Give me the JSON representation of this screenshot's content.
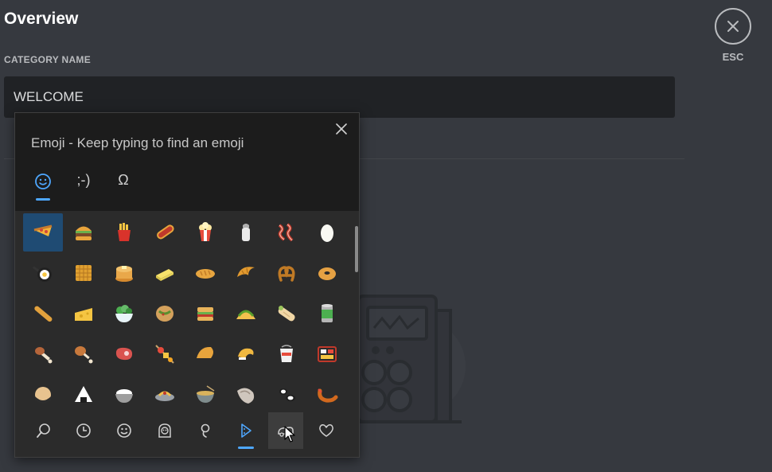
{
  "page": {
    "title": "Overview"
  },
  "category": {
    "label": "CATEGORY NAME",
    "value": "WELCOME"
  },
  "close": {
    "esc_label": "ESC"
  },
  "emoji_panel": {
    "hint": "Emoji - Keep typing to find an emoji",
    "tabs": [
      {
        "name": "emoji",
        "icon": "smiley-icon",
        "active": true
      },
      {
        "name": "kaomoji",
        "label": ";-)",
        "active": false
      },
      {
        "name": "symbols",
        "label": "Ω",
        "active": false
      }
    ],
    "grid_rows": [
      [
        "pizza",
        "hamburger",
        "french-fries",
        "hot-dog",
        "popcorn",
        "salt",
        "bacon",
        "egg"
      ],
      [
        "cooking",
        "waffle",
        "pancakes",
        "butter",
        "bread",
        "croissant",
        "pretzel",
        "bagel"
      ],
      [
        "baguette-bread",
        "cheese-wedge",
        "green-salad",
        "stuffed-flatbread",
        "sandwich",
        "taco",
        "burrito",
        "canned-food"
      ],
      [
        "meat-on-bone",
        "poultry-leg",
        "cut-of-meat",
        "oden",
        "dumpling",
        "fortune-cookie",
        "takeout-box",
        "bento-box"
      ],
      [
        "rice-cracker",
        "rice-ball",
        "cooked-rice",
        "spaghetti",
        "steaming-bowl",
        "oyster",
        "sushi",
        "fried-shrimp"
      ]
    ],
    "selected_emoji": "pizza",
    "categories": [
      {
        "name": "search-icon",
        "active": false
      },
      {
        "name": "recent-icon",
        "active": false
      },
      {
        "name": "smileys-icon",
        "active": false
      },
      {
        "name": "people-icon",
        "active": false
      },
      {
        "name": "celebration-icon",
        "active": false
      },
      {
        "name": "food-icon",
        "active": true
      },
      {
        "name": "transport-icon",
        "active": false
      },
      {
        "name": "heart-icon",
        "active": false
      }
    ]
  },
  "colors": {
    "background": "#36393f",
    "input": "#202225",
    "panel": "#2b2b2b",
    "accent": "#4ea7ff",
    "selected": "#1f4b73"
  }
}
